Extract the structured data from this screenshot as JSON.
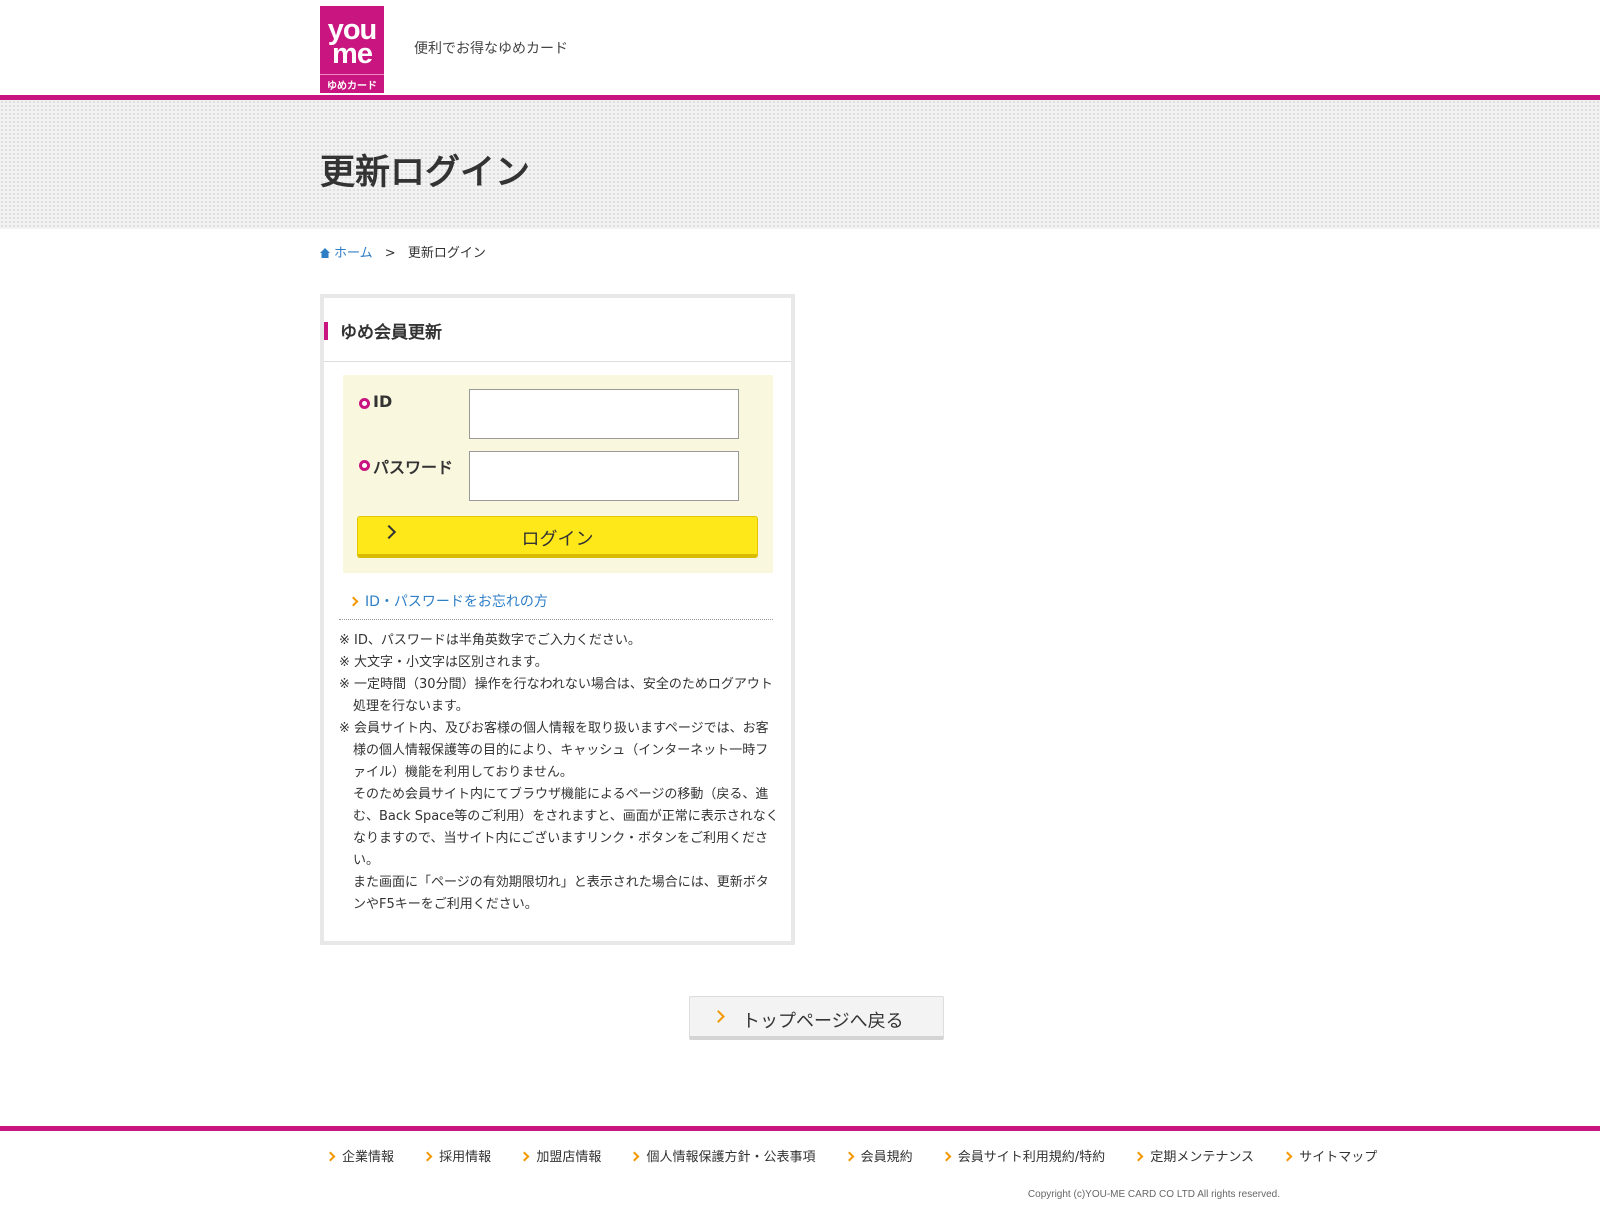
{
  "header": {
    "logo": {
      "line1": "you",
      "line2": "me",
      "line3": "ゆめカード"
    },
    "tagline": "便利でお得なゆめカード"
  },
  "page_title": "更新ログイン",
  "breadcrumb": {
    "home": "ホーム",
    "separator": ">",
    "current": "更新ログイン"
  },
  "panel": {
    "title": "ゆめ会員更新",
    "id_label": "ID",
    "id_value": "",
    "password_label": "パスワード",
    "password_value": "",
    "login_button": "ログイン",
    "forgot_link": "ID・パスワードをお忘れの方",
    "notes": [
      "※ ID、パスワードは半角英数字でご入力ください。",
      "※ 大文字・小文字は区別されます。",
      "※ 一定時間（30分間）操作を行なわれない場合は、安全のためログアウト処理を行ないます。",
      "※ 会員サイト内、及びお客様の個人情報を取り扱いますページでは、お客様の個人情報保護等の目的により、キャッシュ（インターネット一時ファイル）機能を利用しておりません。",
      "そのため会員サイト内にてブラウザ機能によるページの移動（戻る、進む、Back Space等のご利用）をされますと、画面が正常に表示されなくなりますので、当サイト内にございますリンク・ボタンをご利用ください。",
      "また画面に「ページの有効期限切れ」と表示された場合には、更新ボタンやF5キーをご利用ください。"
    ]
  },
  "back_button": "トップページへ戻る",
  "footer": {
    "links": [
      "企業情報",
      "採用情報",
      "加盟店情報",
      "個人情報保護方針・公表事項",
      "会員規約",
      "会員サイト利用規約/特約",
      "定期メンテナンス",
      "サイトマップ"
    ],
    "copyright": "Copyright (c)YOU-ME CARD CO LTD All rights reserved."
  },
  "colors": {
    "brand": "#c8157f",
    "button_yellow": "#ffe81a",
    "link_blue": "#2f7fc7",
    "chevron_orange": "#f39800"
  }
}
